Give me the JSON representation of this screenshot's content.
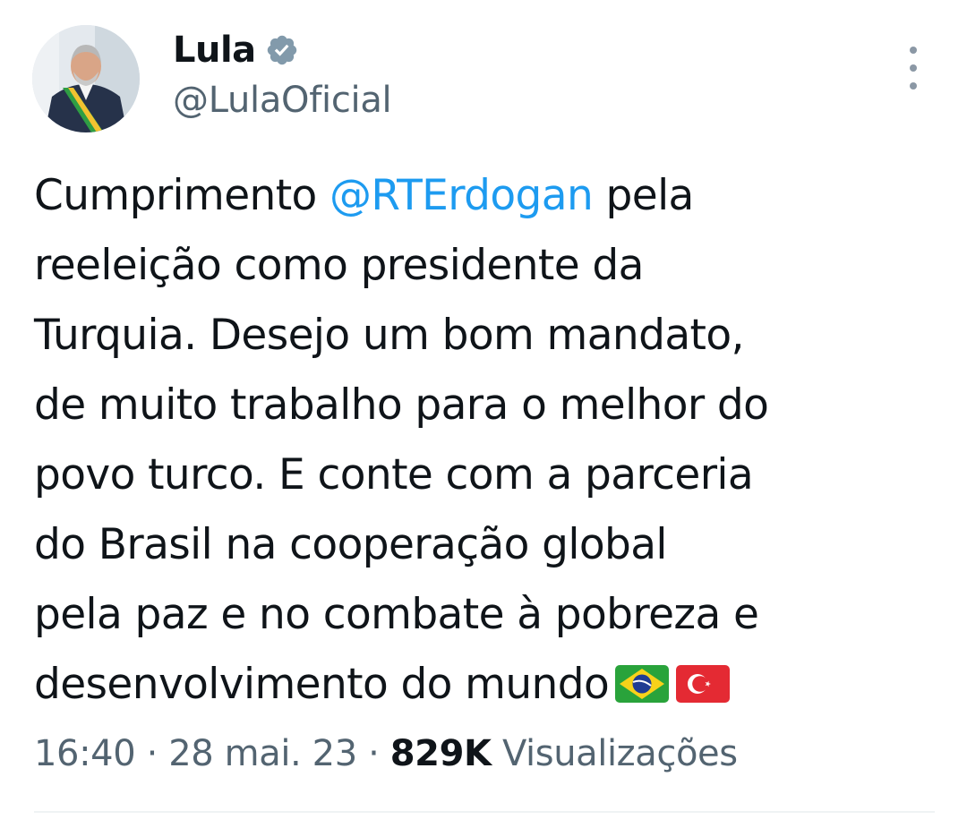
{
  "author": {
    "display_name": "Lula",
    "handle": "@LulaOficial",
    "verified": true
  },
  "tweet": {
    "lines": [
      {
        "before": "Cumprimento ",
        "mention": "@RTErdogan",
        "after": " pela"
      },
      {
        "text": "reeleição como presidente da"
      },
      {
        "text": "Turquia. Desejo um bom mandato,"
      },
      {
        "text": "de muito trabalho para o melhor do"
      },
      {
        "text": "povo turco. E conte com a parceria"
      },
      {
        "text": "do Brasil na cooperação global"
      },
      {
        "text": "pela paz e no combate à pobreza e"
      },
      {
        "text": "desenvolvimento do mundo"
      }
    ],
    "emoji": [
      "brazil-flag",
      "turkey-flag"
    ]
  },
  "meta": {
    "time": "16:40",
    "separator": " · ",
    "date": "28 mai. 23",
    "views_count": "829K",
    "views_label": " Visualizações"
  },
  "colors": {
    "mention": "#1d9bf0",
    "secondary_text": "#536471",
    "primary_text": "#0f1419",
    "verified_badge": "#829aab"
  }
}
